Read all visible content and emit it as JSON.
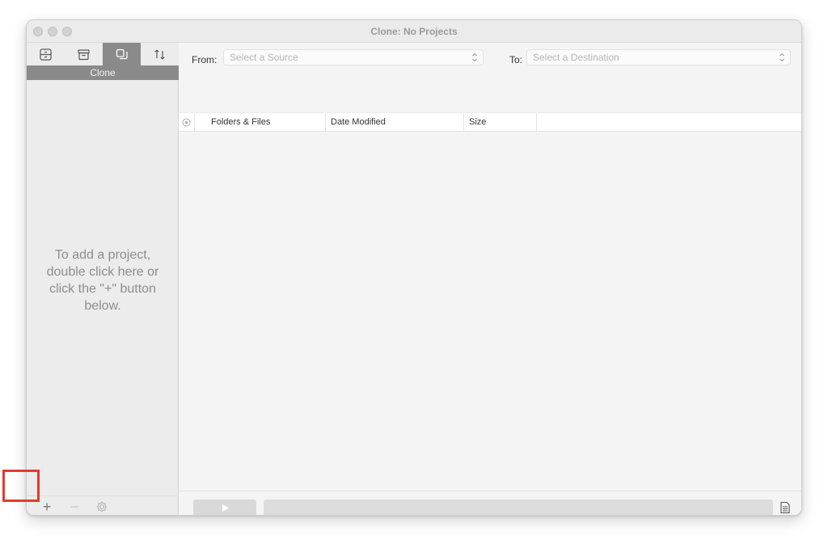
{
  "window": {
    "title": "Clone: No Projects"
  },
  "sidebar": {
    "tabs": [
      {
        "icon": "drive-icon"
      },
      {
        "icon": "archive-icon"
      },
      {
        "icon": "clone-icon",
        "active": true
      },
      {
        "icon": "sync-icon"
      }
    ],
    "active_tab_label": "Clone",
    "empty_hint": "To add a project, double click here or click the \"+\" button below.",
    "add_label": "+",
    "remove_label": "−"
  },
  "toolbar": {
    "from_label": "From:",
    "source_placeholder": "Select a Source",
    "to_label": "To:",
    "destination_placeholder": "Select a Destination"
  },
  "table": {
    "columns": [
      "Folders & Files",
      "Date Modified",
      "Size"
    ]
  },
  "colors": {
    "accent_highlight": "#e23b2e",
    "active_tab": "#8a8a8a"
  }
}
